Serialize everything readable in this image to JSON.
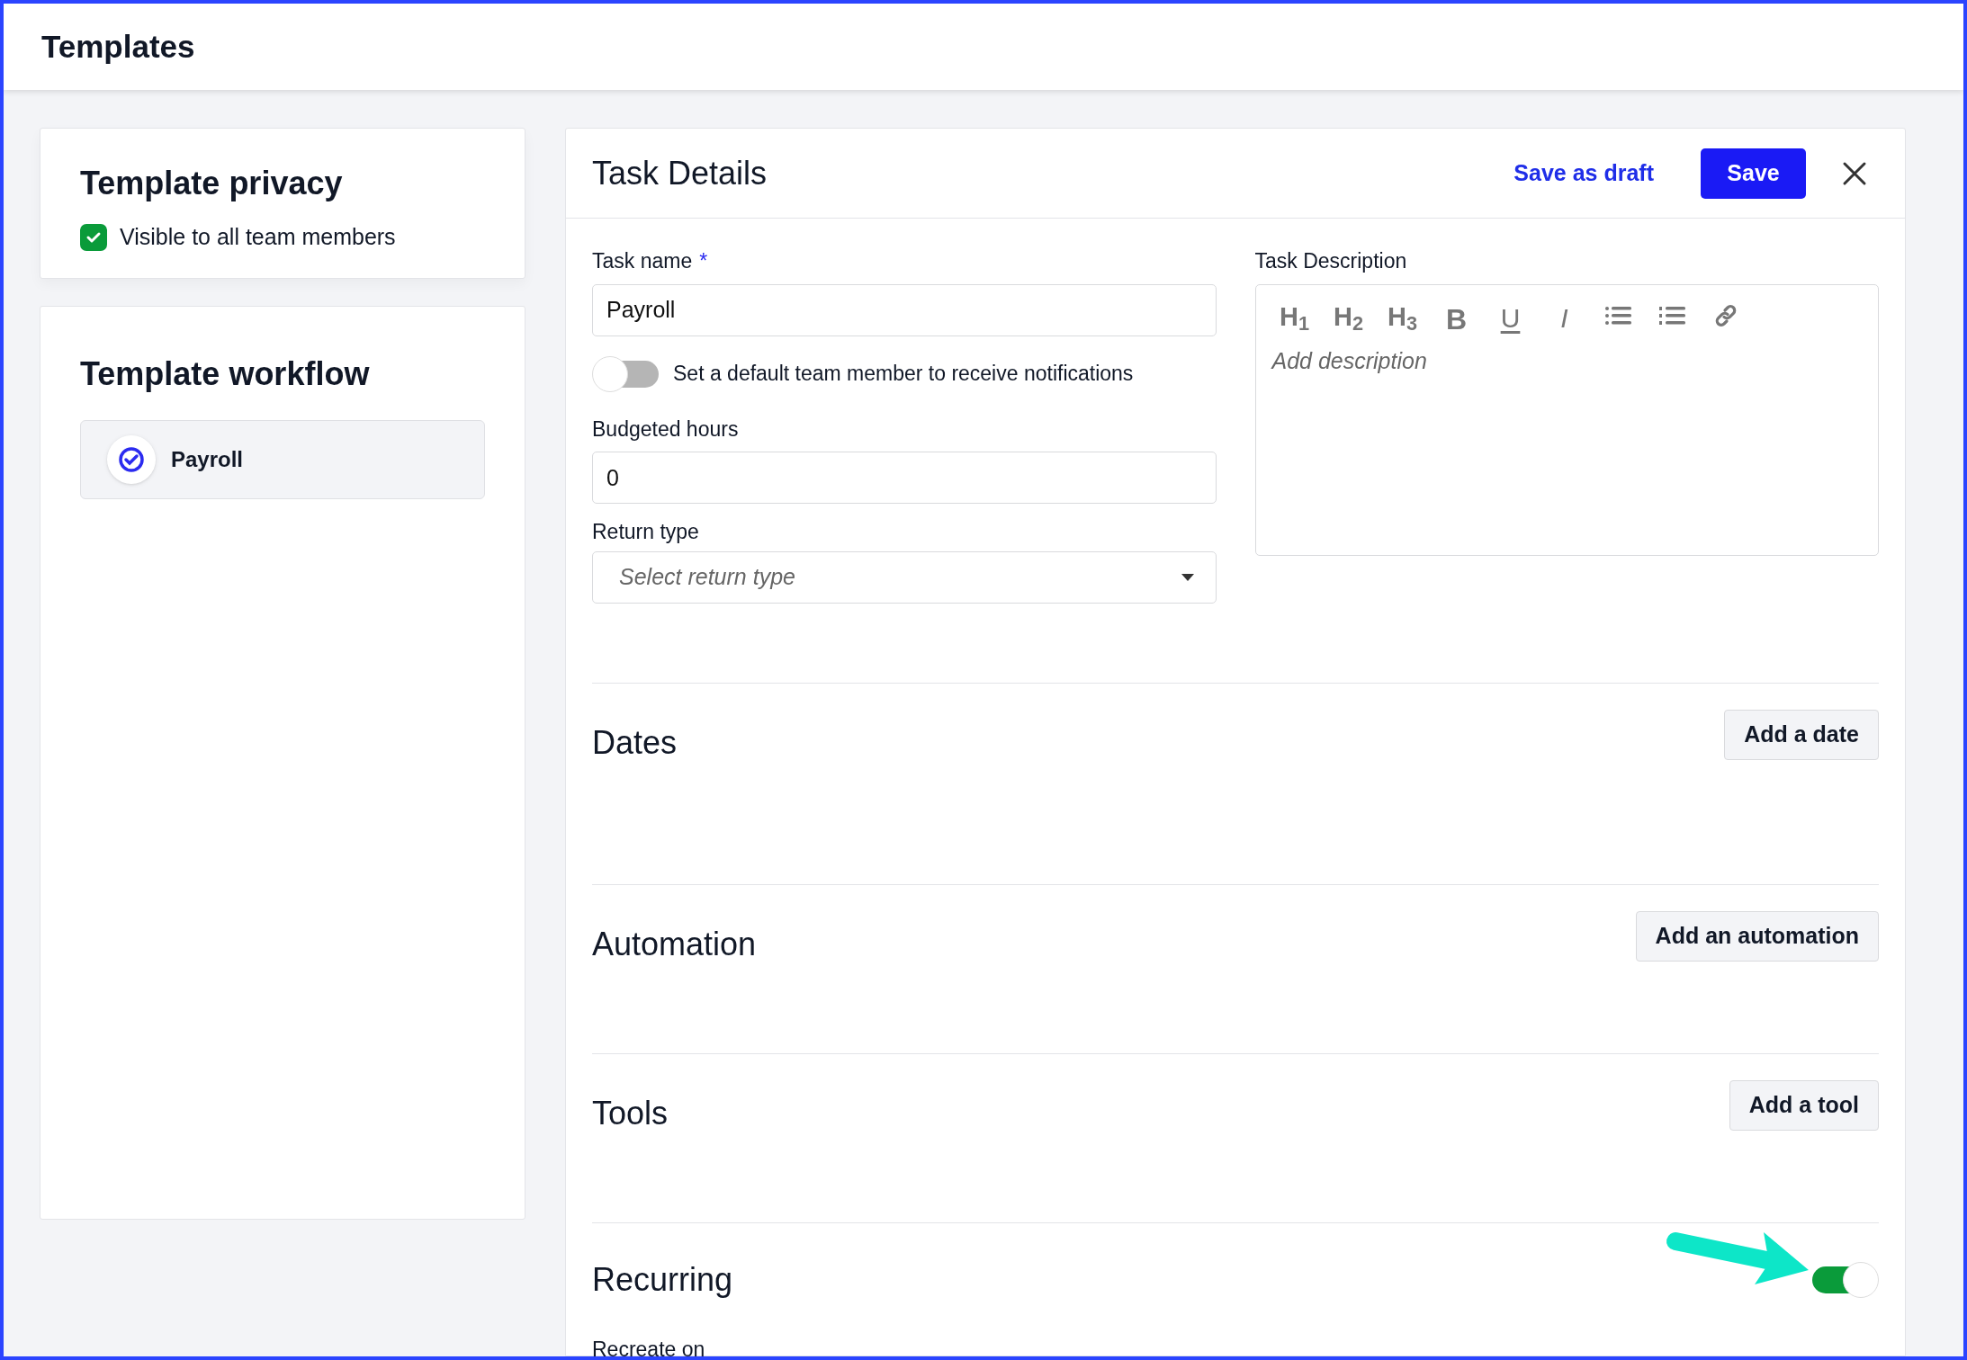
{
  "header": {
    "title": "Templates"
  },
  "privacy": {
    "title": "Template privacy",
    "checkbox": {
      "label": "Visible to all team members",
      "checked": true
    }
  },
  "workflow": {
    "title": "Template workflow",
    "items": [
      {
        "label": "Payroll"
      }
    ]
  },
  "task_details": {
    "title": "Task Details",
    "save_draft": "Save as draft",
    "save": "Save",
    "task_name": {
      "label": "Task name",
      "required_mark": "*",
      "value": "Payroll"
    },
    "notify_toggle": {
      "label": "Set a default team member to receive notifications",
      "on": false
    },
    "budgeted_hours": {
      "label": "Budgeted hours",
      "value": "0"
    },
    "return_type": {
      "label": "Return type",
      "placeholder": "Select return type"
    },
    "description": {
      "label": "Task Description",
      "placeholder": "Add description",
      "toolbar": [
        {
          "kind": "heading",
          "label": "H$_{1}$"
        },
        {
          "kind": "heading",
          "label": "H$_{2}$"
        },
        {
          "kind": "heading",
          "label": "H$_{3}$"
        },
        {
          "kind": "bold",
          "label": "B"
        },
        {
          "kind": "underline",
          "label": "U"
        },
        {
          "kind": "italic",
          "label": "I"
        },
        {
          "kind": "bullet-list"
        },
        {
          "kind": "numbered-list"
        },
        {
          "kind": "link"
        }
      ]
    },
    "sections": [
      {
        "title": "Dates",
        "button": "Add a date"
      },
      {
        "title": "Automation",
        "button": "Add an automation"
      },
      {
        "title": "Tools",
        "button": "Add a tool"
      }
    ],
    "recurring": {
      "title": "Recurring",
      "on": true,
      "recreate_label": "Recreate on"
    }
  }
}
